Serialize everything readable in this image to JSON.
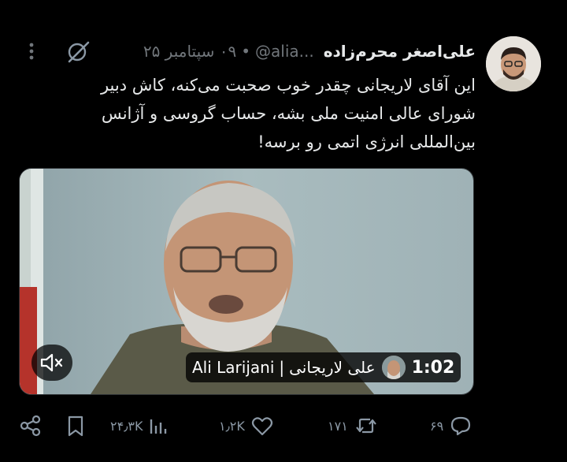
{
  "tweet": {
    "author_name": "علی‌اصغر محرم‌زاده",
    "handle": "@alia...",
    "separator": "•",
    "date": "۰۹ سپتامبر ۲۵",
    "text_lines": [
      "این آقای لاریجانی چقدر خوب صحبت می‌کنه، کاش دبیر",
      "شورای عالی امنیت ملی بشه، حساب گروسی و آژانس",
      "بین‌المللی انرژی اتمی رو برسه!"
    ]
  },
  "media": {
    "caption_en": "Ali Larijani",
    "caption_sep": "|",
    "caption_fa": "علی لاریجانی",
    "duration": "1:02"
  },
  "actions": {
    "reply_count": "۶۹",
    "retweet_count": "۱۷۱",
    "like_count": "۱٫۲K",
    "views_count": "۲۴٫۳K"
  },
  "icons": {
    "more": "more-vertical-icon",
    "grok": "grok-icon",
    "mute": "mute-icon",
    "reply": "reply-icon",
    "retweet": "retweet-icon",
    "like": "like-icon",
    "views": "views-icon",
    "bookmark": "bookmark-icon",
    "share": "share-icon"
  },
  "colors": {
    "background": "#000000",
    "text": "#e7e9ea",
    "secondary": "#71767b",
    "icon": "#8b98a5"
  }
}
